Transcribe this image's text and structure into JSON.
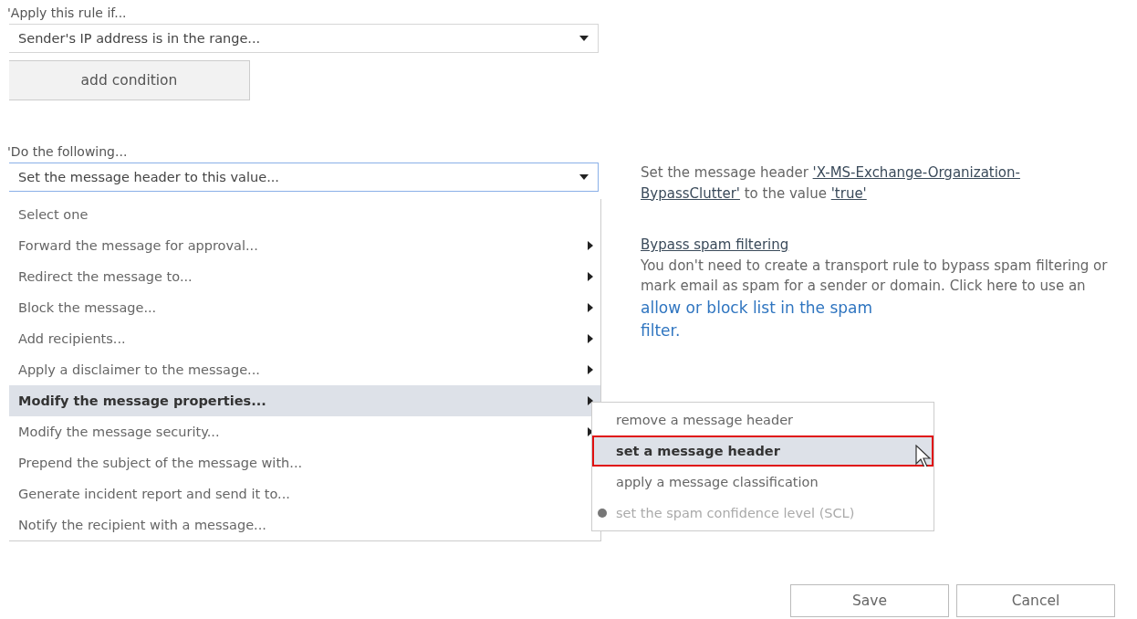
{
  "condition": {
    "label": "'Apply this rule if...",
    "value": "Sender's IP address is in the range...",
    "add_button": "add condition"
  },
  "action": {
    "label": "'Do the following...",
    "value": "Set the message header to this value...",
    "focused": true,
    "menu": [
      {
        "label": "Select one",
        "has_submenu": false,
        "selected": false
      },
      {
        "label": "Forward the message for approval...",
        "has_submenu": true,
        "selected": false
      },
      {
        "label": "Redirect the message to...",
        "has_submenu": true,
        "selected": false
      },
      {
        "label": "Block the message...",
        "has_submenu": true,
        "selected": false
      },
      {
        "label": "Add recipients...",
        "has_submenu": true,
        "selected": false
      },
      {
        "label": "Apply a disclaimer to the message...",
        "has_submenu": true,
        "selected": false
      },
      {
        "label": "Modify the message properties...",
        "has_submenu": true,
        "selected": true
      },
      {
        "label": "Modify the message security...",
        "has_submenu": true,
        "selected": false
      },
      {
        "label": "Prepend the subject of the message with...",
        "has_submenu": false,
        "selected": false
      },
      {
        "label": "Generate incident report and send it to...",
        "has_submenu": false,
        "selected": false
      },
      {
        "label": "Notify the recipient with a message...",
        "has_submenu": false,
        "selected": false
      }
    ],
    "submenu": [
      {
        "label": "remove a message header",
        "selected": false,
        "disabled": false
      },
      {
        "label": "set a message header",
        "selected": true,
        "disabled": false
      },
      {
        "label": "apply a message classification",
        "selected": false,
        "disabled": false
      },
      {
        "label": "set the spam confidence level (SCL)",
        "selected": false,
        "disabled": true
      }
    ]
  },
  "description": {
    "prefix": "Set the message header",
    "header_link": [
      "'X-MS-Exchange-Organization-",
      "BypassClutter'"
    ],
    "middle": "to the value",
    "value_link": "'true'"
  },
  "tip": {
    "title": "Bypass spam filtering",
    "text": "You don't need to create a transport rule to bypass spam filtering or mark email as spam for a sender or domain. Click here to use an",
    "link": [
      "allow or block list in the spam",
      "filter."
    ]
  },
  "buttons": [
    "Save",
    "Cancel"
  ]
}
